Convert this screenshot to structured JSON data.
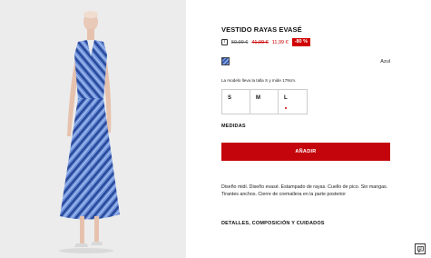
{
  "product": {
    "title": "VESTIDO RAYAS EVASÉ",
    "price": {
      "original": "59,99 €",
      "previous": "41,99 €",
      "current": "11,99 €",
      "discount": "-80 %"
    },
    "color": {
      "name": "Azul",
      "swatch_hex": "#5b7fd4"
    },
    "model_note": "La modelo lleva la talla S y mide 179cm.",
    "sizes": [
      {
        "label": "S",
        "low_stock": false
      },
      {
        "label": "M",
        "low_stock": false
      },
      {
        "label": "L",
        "low_stock": true
      }
    ],
    "measures_label": "MEDIDAS",
    "add_button_label": "AÑADIR",
    "description": "Diseño midi. Diseño evasé. Estampado de rayas. Cuello de pico. Sin mangas. Tirantes anchos. Cierre de cremallera en la parte posterior",
    "details_label": "DETALLES, COMPOSICIÓN Y CUIDADOS"
  },
  "colors": {
    "accent": "#c4060c",
    "discount_bg": "#d10000",
    "sale_text": "#cc0000",
    "dress_blue": "#5b7fd4",
    "dress_navy": "#1f3a8a"
  },
  "icons": {
    "info": "info-icon",
    "chat": "chat-icon"
  }
}
